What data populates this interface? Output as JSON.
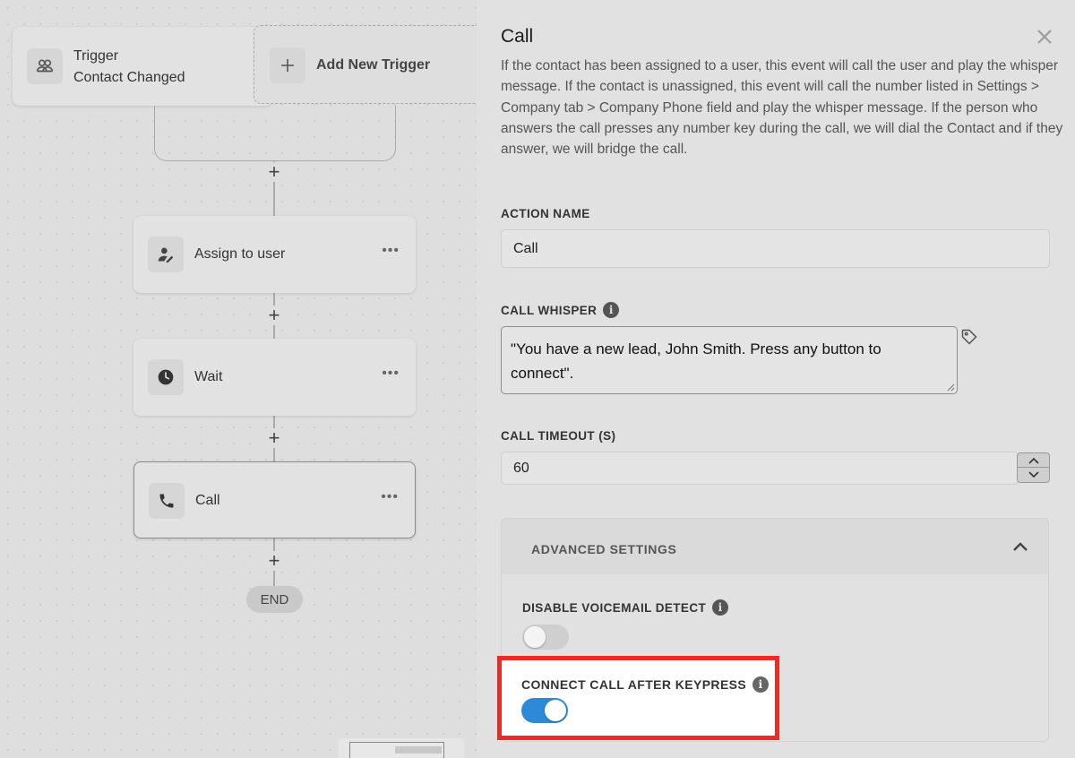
{
  "canvas": {
    "trigger": {
      "title": "Trigger",
      "subtitle": "Contact Changed",
      "icon": "users-icon"
    },
    "add_trigger": {
      "label": "Add New Trigger",
      "icon": "plus-icon"
    },
    "add_step_symbol": "+",
    "steps": [
      {
        "label": "Assign to user",
        "icon": "assign-user-icon",
        "menu": "•••"
      },
      {
        "label": "Wait",
        "icon": "clock-icon",
        "menu": "•••"
      },
      {
        "label": "Call",
        "icon": "phone-icon",
        "menu": "•••",
        "selected": true
      }
    ],
    "end_label": "END"
  },
  "panel": {
    "title": "Call",
    "description": "If the contact has been assigned to a user, this event will call the user and play the whisper message. If the contact is unassigned, this event will call the number listed in Settings > Company tab > Company Phone field and play the whisper message. If the person who answers the call presses any number key during the call, we will dial the Contact and if they answer, we will bridge the call.",
    "action_name": {
      "label": "ACTION NAME",
      "value": "Call"
    },
    "call_whisper": {
      "label": "CALL WHISPER",
      "value": "\"You have a new lead, John Smith. Press any button to connect\"."
    },
    "call_timeout": {
      "label": "CALL TIMEOUT (S)",
      "value": "60"
    },
    "advanced": {
      "title": "ADVANCED SETTINGS",
      "disable_voicemail": {
        "label": "DISABLE VOICEMAIL DETECT",
        "enabled": false
      },
      "connect_after_keypress": {
        "label": "CONNECT CALL AFTER KEYPRESS",
        "enabled": true
      }
    }
  },
  "colors": {
    "toggle_on": "#2d8ad9",
    "highlight_border": "#ee2a24"
  }
}
